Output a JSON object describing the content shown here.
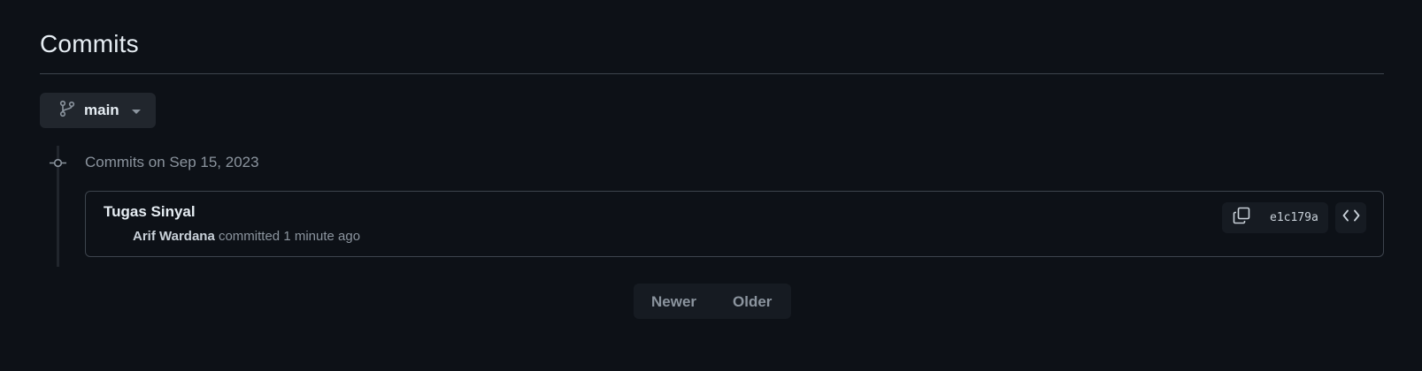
{
  "page": {
    "title": "Commits"
  },
  "branch": {
    "label": "main",
    "icon": "git-branch-icon"
  },
  "timeline": {
    "group_heading": "Commits on Sep 15, 2023",
    "commits": [
      {
        "title": "Tugas Sinyal",
        "author": "Arif Wardana",
        "action": " committed ",
        "time": "1 minute ago",
        "sha": "e1c179a"
      }
    ]
  },
  "pagination": {
    "newer_label": "Newer",
    "older_label": "Older"
  },
  "colors": {
    "background": "#0d1117",
    "surface": "#161b22",
    "border": "#3d444d",
    "text_primary": "#e6edf3",
    "text_muted": "#8b949e"
  }
}
